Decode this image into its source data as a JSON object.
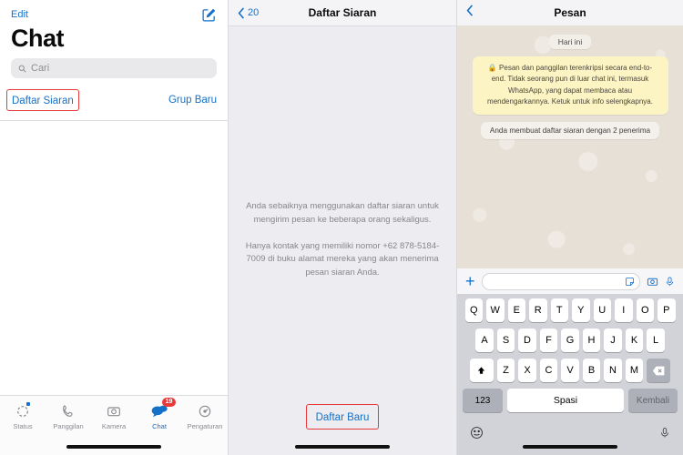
{
  "panel1": {
    "edit_label": "Edit",
    "compose_icon": "compose-square-pencil-icon",
    "title": "Chat",
    "search": {
      "placeholder": "Cari",
      "icon": "search-icon"
    },
    "broadcast_link": "Daftar Siaran",
    "new_group_link": "Grup Baru",
    "highlight_color": "#e8393b",
    "link_color": "#1570c8",
    "tabs": [
      {
        "label": "Status",
        "icon": "status-ring-icon",
        "active": false,
        "badge": ""
      },
      {
        "label": "Panggilan",
        "icon": "phone-icon",
        "active": false,
        "badge": ""
      },
      {
        "label": "Kamera",
        "icon": "camera-icon",
        "active": false,
        "badge": ""
      },
      {
        "label": "Chat",
        "icon": "chat-bubbles-icon",
        "active": true,
        "badge": "19"
      },
      {
        "label": "Pengaturan",
        "icon": "settings-gear-icon",
        "active": false,
        "badge": ""
      }
    ]
  },
  "panel2": {
    "back_label": "20",
    "back_icon": "chevron-left-icon",
    "nav_title": "Daftar Siaran",
    "paragraph1": "Anda sebaiknya menggunakan daftar siaran untuk mengirim pesan ke beberapa orang sekaligus.",
    "paragraph2": "Hanya kontak yang memiliki nomor +62 878-5184-7009 di buku alamat mereka yang akan menerima pesan siaran Anda.",
    "cta_label": "Daftar Baru",
    "highlight_color": "#e8393b"
  },
  "panel3": {
    "back_icon": "chevron-left-icon",
    "nav_title": "Pesan",
    "date_pill": "Hari ini",
    "encryption_icon": "lock-icon",
    "encryption_notice": "Pesan dan panggilan terenkripsi secara end-to-end. Tidak seorang pun di luar chat ini, termasuk WhatsApp, yang dapat membaca atau mendengarkannya. Ketuk untuk info selengkapnya.",
    "system_message": "Anda membuat daftar siaran dengan 2 penerima",
    "compose": {
      "plus_icon": "plus-icon",
      "input_placeholder": "",
      "sticker_icon": "sticker-icon",
      "camera_icon": "camera-icon",
      "mic_icon": "microphone-icon"
    },
    "keyboard": {
      "row1": [
        "Q",
        "W",
        "E",
        "R",
        "T",
        "Y",
        "U",
        "I",
        "O",
        "P"
      ],
      "row2": [
        "A",
        "S",
        "D",
        "F",
        "G",
        "H",
        "J",
        "K",
        "L"
      ],
      "row3": [
        "Z",
        "X",
        "C",
        "V",
        "B",
        "N",
        "M"
      ],
      "shift_icon": "shift-arrow-icon",
      "backspace_icon": "backspace-icon",
      "numeric_label": "123",
      "space_label": "Spasi",
      "return_label": "Kembali",
      "emoji_icon": "emoji-smiley-icon",
      "dictation_icon": "microphone-icon"
    }
  }
}
